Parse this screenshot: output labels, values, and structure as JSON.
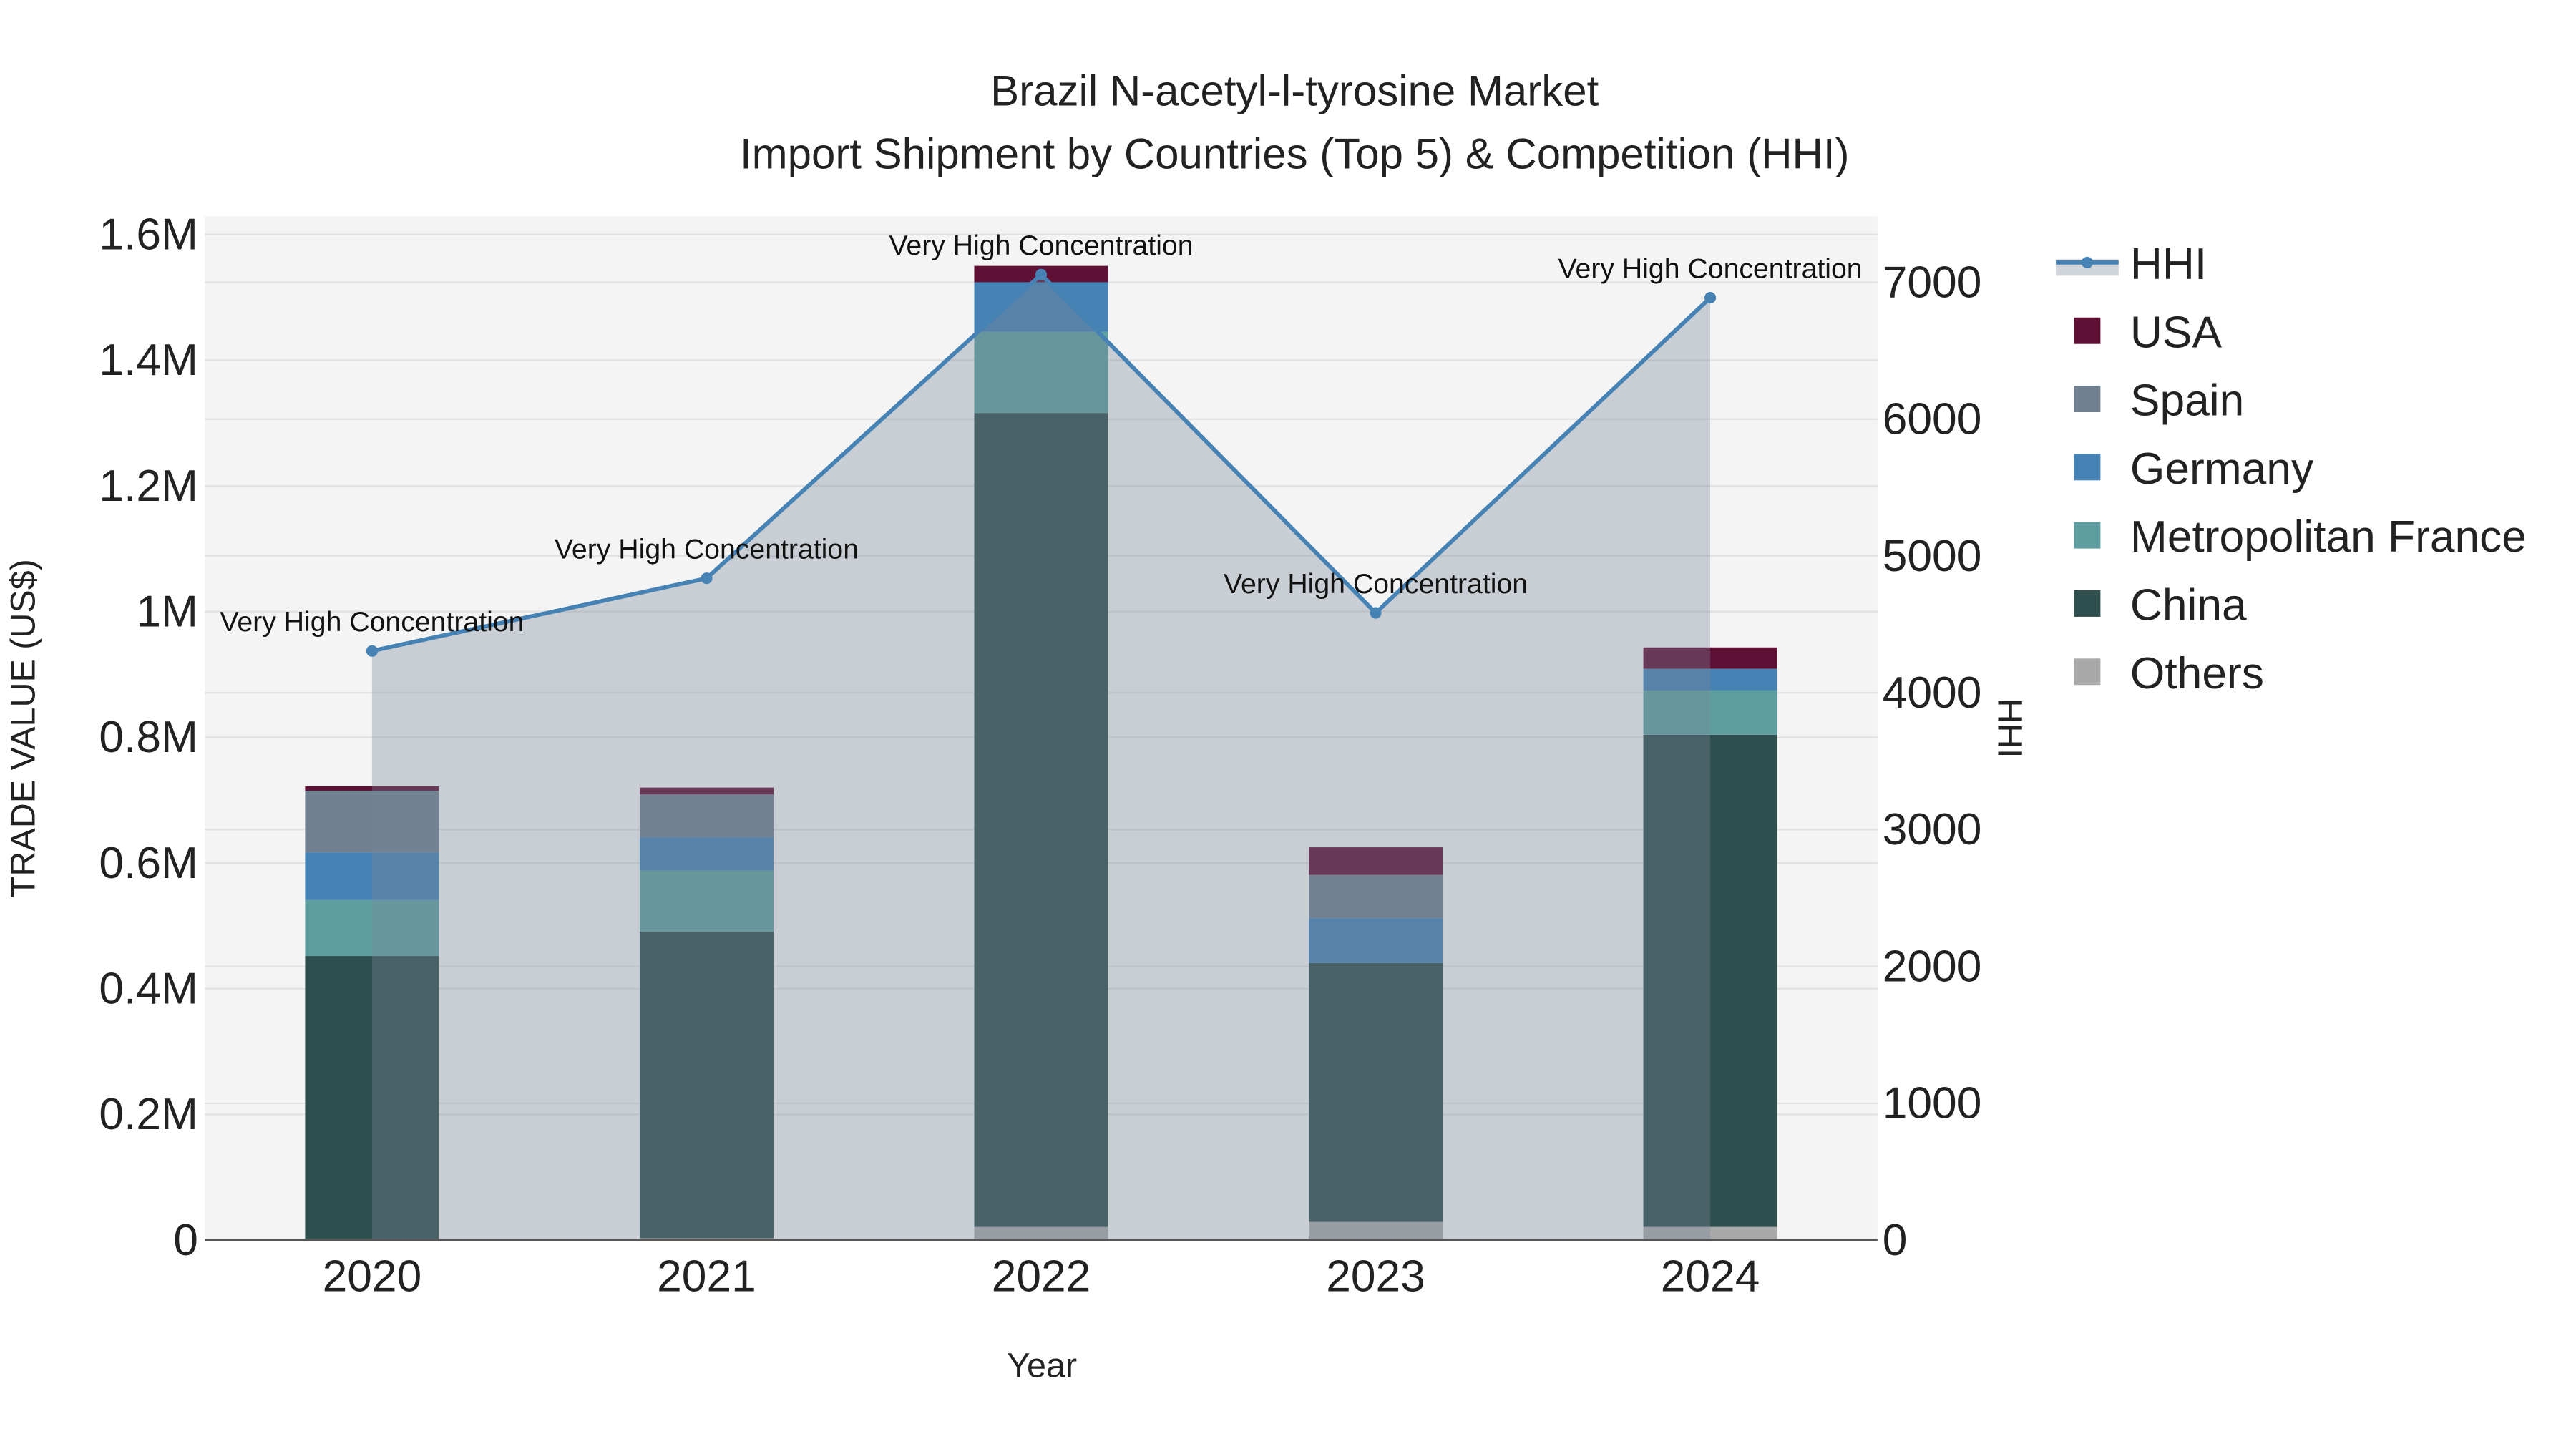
{
  "chart_data": {
    "type": "bar",
    "title": "Brazil N-acetyl-l-tyrosine Market",
    "subtitle": "Import Shipment by Countries (Top 5) & Competition (HHI)",
    "xlabel": "Year",
    "ylabel": "TRADE VALUE (US$)",
    "y2label": "HHI",
    "categories": [
      "2020",
      "2021",
      "2022",
      "2023",
      "2024"
    ],
    "ylim": [
      0,
      1600000
    ],
    "y2lim": [
      0,
      7300
    ],
    "yticks": [
      0,
      200000,
      400000,
      600000,
      800000,
      1000000,
      1200000,
      1400000,
      1600000
    ],
    "ytick_labels": [
      "0",
      "0.2M",
      "0.4M",
      "0.6M",
      "0.8M",
      "1M",
      "1.2M",
      "1.4M",
      "1.6M"
    ],
    "y2ticks": [
      0,
      1000,
      2000,
      3000,
      4000,
      5000,
      6000,
      7000
    ],
    "y2tick_labels": [
      "0",
      "1000",
      "2000",
      "3000",
      "4000",
      "5000",
      "6000",
      "7000"
    ],
    "grid": true,
    "legend_position": "right",
    "series": [
      {
        "name": "Others",
        "color": "#a9a9a9",
        "values": [
          0,
          3000,
          21000,
          29000,
          21000
        ]
      },
      {
        "name": "China",
        "color": "#2f4f4f",
        "values": [
          452000,
          488000,
          1295000,
          412000,
          783000
        ]
      },
      {
        "name": "Metropolitan France",
        "color": "#5f9ea0",
        "values": [
          89000,
          97000,
          129000,
          0,
          71000
        ]
      },
      {
        "name": "Germany",
        "color": "#4682b4",
        "values": [
          76000,
          53000,
          79000,
          71000,
          34000
        ]
      },
      {
        "name": "Spain",
        "color": "#708090",
        "values": [
          98000,
          68000,
          0,
          69000,
          0
        ]
      },
      {
        "name": "USA",
        "color": "#5e1035",
        "values": [
          7000,
          11000,
          26000,
          44000,
          34000
        ]
      }
    ],
    "hhi": {
      "name": "HHI",
      "color": "#4682b4",
      "values": [
        4306,
        4837,
        7057,
        4584,
        6888
      ],
      "annotations": [
        "Very High Concentration",
        "Very High Concentration",
        "Very High Concentration",
        "Very High Concentration",
        "Very High Concentration"
      ]
    },
    "legend_order": [
      "HHI",
      "USA",
      "Spain",
      "Germany",
      "Metropolitan France",
      "China",
      "Others"
    ]
  }
}
